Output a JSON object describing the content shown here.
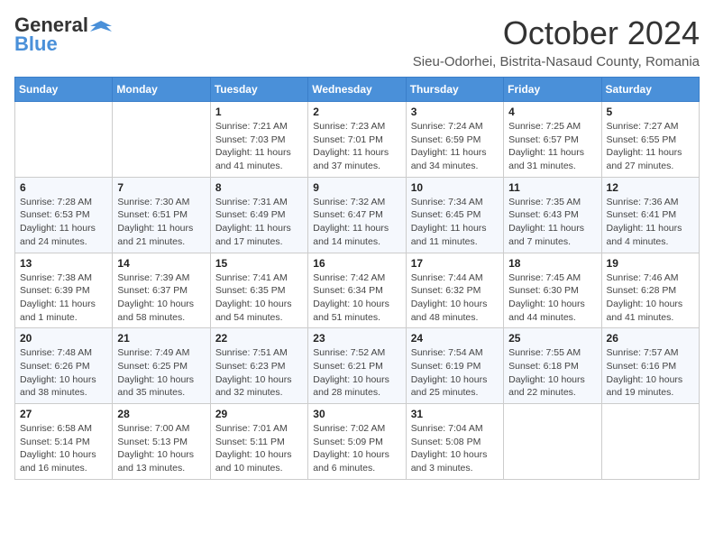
{
  "logo": {
    "general": "General",
    "blue": "Blue"
  },
  "title": "October 2024",
  "location": "Sieu-Odorhei, Bistrita-Nasaud County, Romania",
  "days_of_week": [
    "Sunday",
    "Monday",
    "Tuesday",
    "Wednesday",
    "Thursday",
    "Friday",
    "Saturday"
  ],
  "weeks": [
    [
      {
        "day": "",
        "info": ""
      },
      {
        "day": "",
        "info": ""
      },
      {
        "day": "1",
        "info": "Sunrise: 7:21 AM\nSunset: 7:03 PM\nDaylight: 11 hours and 41 minutes."
      },
      {
        "day": "2",
        "info": "Sunrise: 7:23 AM\nSunset: 7:01 PM\nDaylight: 11 hours and 37 minutes."
      },
      {
        "day": "3",
        "info": "Sunrise: 7:24 AM\nSunset: 6:59 PM\nDaylight: 11 hours and 34 minutes."
      },
      {
        "day": "4",
        "info": "Sunrise: 7:25 AM\nSunset: 6:57 PM\nDaylight: 11 hours and 31 minutes."
      },
      {
        "day": "5",
        "info": "Sunrise: 7:27 AM\nSunset: 6:55 PM\nDaylight: 11 hours and 27 minutes."
      }
    ],
    [
      {
        "day": "6",
        "info": "Sunrise: 7:28 AM\nSunset: 6:53 PM\nDaylight: 11 hours and 24 minutes."
      },
      {
        "day": "7",
        "info": "Sunrise: 7:30 AM\nSunset: 6:51 PM\nDaylight: 11 hours and 21 minutes."
      },
      {
        "day": "8",
        "info": "Sunrise: 7:31 AM\nSunset: 6:49 PM\nDaylight: 11 hours and 17 minutes."
      },
      {
        "day": "9",
        "info": "Sunrise: 7:32 AM\nSunset: 6:47 PM\nDaylight: 11 hours and 14 minutes."
      },
      {
        "day": "10",
        "info": "Sunrise: 7:34 AM\nSunset: 6:45 PM\nDaylight: 11 hours and 11 minutes."
      },
      {
        "day": "11",
        "info": "Sunrise: 7:35 AM\nSunset: 6:43 PM\nDaylight: 11 hours and 7 minutes."
      },
      {
        "day": "12",
        "info": "Sunrise: 7:36 AM\nSunset: 6:41 PM\nDaylight: 11 hours and 4 minutes."
      }
    ],
    [
      {
        "day": "13",
        "info": "Sunrise: 7:38 AM\nSunset: 6:39 PM\nDaylight: 11 hours and 1 minute."
      },
      {
        "day": "14",
        "info": "Sunrise: 7:39 AM\nSunset: 6:37 PM\nDaylight: 10 hours and 58 minutes."
      },
      {
        "day": "15",
        "info": "Sunrise: 7:41 AM\nSunset: 6:35 PM\nDaylight: 10 hours and 54 minutes."
      },
      {
        "day": "16",
        "info": "Sunrise: 7:42 AM\nSunset: 6:34 PM\nDaylight: 10 hours and 51 minutes."
      },
      {
        "day": "17",
        "info": "Sunrise: 7:44 AM\nSunset: 6:32 PM\nDaylight: 10 hours and 48 minutes."
      },
      {
        "day": "18",
        "info": "Sunrise: 7:45 AM\nSunset: 6:30 PM\nDaylight: 10 hours and 44 minutes."
      },
      {
        "day": "19",
        "info": "Sunrise: 7:46 AM\nSunset: 6:28 PM\nDaylight: 10 hours and 41 minutes."
      }
    ],
    [
      {
        "day": "20",
        "info": "Sunrise: 7:48 AM\nSunset: 6:26 PM\nDaylight: 10 hours and 38 minutes."
      },
      {
        "day": "21",
        "info": "Sunrise: 7:49 AM\nSunset: 6:25 PM\nDaylight: 10 hours and 35 minutes."
      },
      {
        "day": "22",
        "info": "Sunrise: 7:51 AM\nSunset: 6:23 PM\nDaylight: 10 hours and 32 minutes."
      },
      {
        "day": "23",
        "info": "Sunrise: 7:52 AM\nSunset: 6:21 PM\nDaylight: 10 hours and 28 minutes."
      },
      {
        "day": "24",
        "info": "Sunrise: 7:54 AM\nSunset: 6:19 PM\nDaylight: 10 hours and 25 minutes."
      },
      {
        "day": "25",
        "info": "Sunrise: 7:55 AM\nSunset: 6:18 PM\nDaylight: 10 hours and 22 minutes."
      },
      {
        "day": "26",
        "info": "Sunrise: 7:57 AM\nSunset: 6:16 PM\nDaylight: 10 hours and 19 minutes."
      }
    ],
    [
      {
        "day": "27",
        "info": "Sunrise: 6:58 AM\nSunset: 5:14 PM\nDaylight: 10 hours and 16 minutes."
      },
      {
        "day": "28",
        "info": "Sunrise: 7:00 AM\nSunset: 5:13 PM\nDaylight: 10 hours and 13 minutes."
      },
      {
        "day": "29",
        "info": "Sunrise: 7:01 AM\nSunset: 5:11 PM\nDaylight: 10 hours and 10 minutes."
      },
      {
        "day": "30",
        "info": "Sunrise: 7:02 AM\nSunset: 5:09 PM\nDaylight: 10 hours and 6 minutes."
      },
      {
        "day": "31",
        "info": "Sunrise: 7:04 AM\nSunset: 5:08 PM\nDaylight: 10 hours and 3 minutes."
      },
      {
        "day": "",
        "info": ""
      },
      {
        "day": "",
        "info": ""
      }
    ]
  ]
}
